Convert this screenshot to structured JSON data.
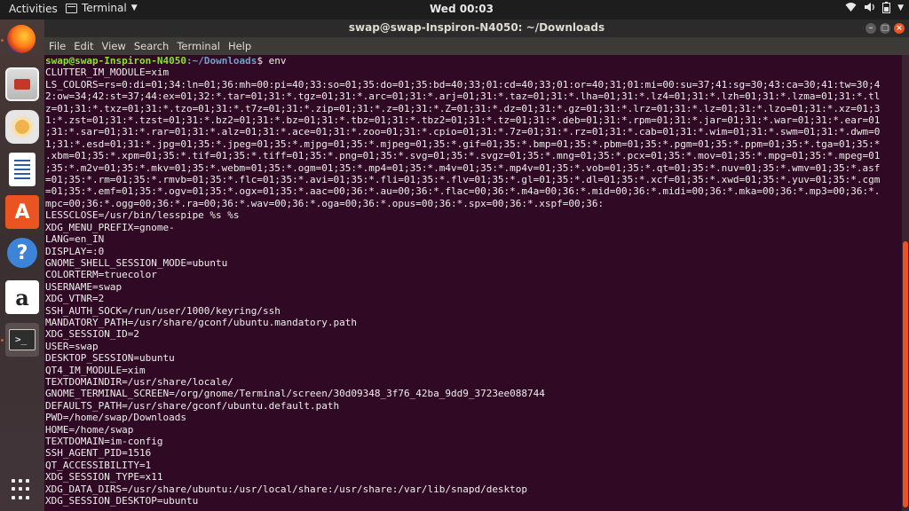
{
  "top_bar": {
    "activities": "Activities",
    "app_name": "Terminal",
    "clock": "Wed 00:03"
  },
  "window": {
    "title": "swap@swap-Inspiron-N4050: ~/Downloads",
    "menu": [
      "File",
      "Edit",
      "View",
      "Search",
      "Terminal",
      "Help"
    ]
  },
  "dock": {
    "icons": [
      "firefox-icon",
      "files-icon",
      "rhythmbox-icon",
      "libreoffice-writer-icon",
      "software-center-icon",
      "help-icon",
      "amazon-icon",
      "terminal-icon",
      "show-applications-icon"
    ],
    "help_glyph": "?",
    "amazon_glyph": "a",
    "store_glyph": "A",
    "terminal_glyph": ">_"
  },
  "terminal": {
    "prompt_user": "swap@swap-Inspiron-N4050",
    "prompt_path": ":~/Downloads",
    "command": "$ env",
    "lines": [
      "CLUTTER_IM_MODULE=xim",
      "LS_COLORS=rs=0:di=01;34:ln=01;36:mh=00:pi=40;33:so=01;35:do=01;35:bd=40;33;01:cd=40;33;01:or=40;31;01:mi=00:su=37;41:sg=30;43:ca=30;41:tw=30;4",
      "2:ow=34;42:st=37;44:ex=01;32:*.tar=01;31:*.tgz=01;31:*.arc=01;31:*.arj=01;31:*.taz=01;31:*.lha=01;31:*.lz4=01;31:*.lzh=01;31:*.lzma=01;31:*.tl",
      "z=01;31:*.txz=01;31:*.tzo=01;31:*.t7z=01;31:*.zip=01;31:*.z=01;31:*.Z=01;31:*.dz=01;31:*.gz=01;31:*.lrz=01;31:*.lz=01;31:*.lzo=01;31:*.xz=01;3",
      "1:*.zst=01;31:*.tzst=01;31:*.bz2=01;31:*.bz=01;31:*.tbz=01;31:*.tbz2=01;31:*.tz=01;31:*.deb=01;31:*.rpm=01;31:*.jar=01;31:*.war=01;31:*.ear=01",
      ";31:*.sar=01;31:*.rar=01;31:*.alz=01;31:*.ace=01;31:*.zoo=01;31:*.cpio=01;31:*.7z=01;31:*.rz=01;31:*.cab=01;31:*.wim=01;31:*.swm=01;31:*.dwm=0",
      "1;31:*.esd=01;31:*.jpg=01;35:*.jpeg=01;35:*.mjpg=01;35:*.mjpeg=01;35:*.gif=01;35:*.bmp=01;35:*.pbm=01;35:*.pgm=01;35:*.ppm=01;35:*.tga=01;35:*",
      ".xbm=01;35:*.xpm=01;35:*.tif=01;35:*.tiff=01;35:*.png=01;35:*.svg=01;35:*.svgz=01;35:*.mng=01;35:*.pcx=01;35:*.mov=01;35:*.mpg=01;35:*.mpeg=01",
      ";35:*.m2v=01;35:*.mkv=01;35:*.webm=01;35:*.ogm=01;35:*.mp4=01;35:*.m4v=01;35:*.mp4v=01;35:*.vob=01;35:*.qt=01;35:*.nuv=01;35:*.wmv=01;35:*.asf",
      "=01;35:*.rm=01;35:*.rmvb=01;35:*.flc=01;35:*.avi=01;35:*.fli=01;35:*.flv=01;35:*.gl=01;35:*.dl=01;35:*.xcf=01;35:*.xwd=01;35:*.yuv=01;35:*.cgm",
      "=01;35:*.emf=01;35:*.ogv=01;35:*.ogx=01;35:*.aac=00;36:*.au=00;36:*.flac=00;36:*.m4a=00;36:*.mid=00;36:*.midi=00;36:*.mka=00;36:*.mp3=00;36:*.",
      "mpc=00;36:*.ogg=00;36:*.ra=00;36:*.wav=00;36:*.oga=00;36:*.opus=00;36:*.spx=00;36:*.xspf=00;36:",
      "LESSCLOSE=/usr/bin/lesspipe %s %s",
      "XDG_MENU_PREFIX=gnome-",
      "LANG=en_IN",
      "DISPLAY=:0",
      "GNOME_SHELL_SESSION_MODE=ubuntu",
      "COLORTERM=truecolor",
      "USERNAME=swap",
      "XDG_VTNR=2",
      "SSH_AUTH_SOCK=/run/user/1000/keyring/ssh",
      "MANDATORY_PATH=/usr/share/gconf/ubuntu.mandatory.path",
      "XDG_SESSION_ID=2",
      "USER=swap",
      "DESKTOP_SESSION=ubuntu",
      "QT4_IM_MODULE=xim",
      "TEXTDOMAINDIR=/usr/share/locale/",
      "GNOME_TERMINAL_SCREEN=/org/gnome/Terminal/screen/30d09348_3f76_42ba_9dd9_3723ee088744",
      "DEFAULTS_PATH=/usr/share/gconf/ubuntu.default.path",
      "PWD=/home/swap/Downloads",
      "HOME=/home/swap",
      "TEXTDOMAIN=im-config",
      "SSH_AGENT_PID=1516",
      "QT_ACCESSIBILITY=1",
      "XDG_SESSION_TYPE=x11",
      "XDG_DATA_DIRS=/usr/share/ubuntu:/usr/local/share:/usr/share:/var/lib/snapd/desktop",
      "XDG_SESSION_DESKTOP=ubuntu"
    ]
  },
  "colors": {
    "terminal_bg": "#300a24",
    "accent": "#e95420",
    "prompt_user": "#8ae234",
    "prompt_path": "#729fcf"
  }
}
